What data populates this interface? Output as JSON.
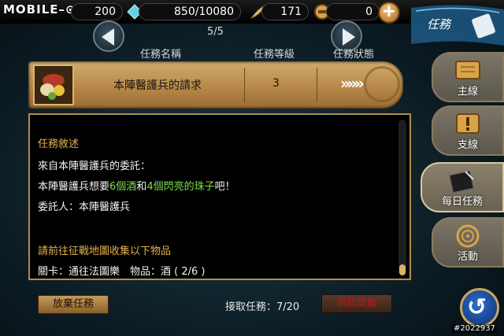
{
  "watermark": "MOBILE–",
  "resources": {
    "energy": "200",
    "crystal": "850/10080",
    "feather": "171",
    "coin": "0"
  },
  "plus_label": "+",
  "page_indicator": "5/5",
  "headers": {
    "name": "任務名稱",
    "level": "任務等級",
    "status": "任務狀態"
  },
  "quest": {
    "name": "本陣醫護兵的請求",
    "level": "3",
    "status": "»»»"
  },
  "detail": {
    "section1_title": "任務敘述",
    "line1": "來自本陣醫護兵的委託：",
    "line2_pre": "本陣醫護兵想要",
    "line2_item1": "6個酒",
    "line2_and": "和",
    "line2_item2": "4個閃亮的珠子",
    "line2_post": "吧！",
    "line3": "委託人：本陣醫護兵",
    "section2_title": "請前往征戰地圖收集以下物品",
    "line4": "關卡：通往法圖樂　物品：酒 ( 2/6 )"
  },
  "buttons": {
    "abandon": "放棄任務",
    "claim": "領取獎勵"
  },
  "accept_count": "接取任務：7/20",
  "sidebar": {
    "title": "任務",
    "tabs": [
      {
        "label": "主線",
        "icon": "scroll-icon"
      },
      {
        "label": "支線",
        "icon": "exclamation-icon"
      },
      {
        "label": "每日任務",
        "icon": "book-icon"
      },
      {
        "label": "活動",
        "icon": "target-icon"
      }
    ]
  },
  "image_id": "#2022937",
  "colors": {
    "gold": "#e3b24c",
    "green": "#7be04d",
    "claim_text": "#b01c1c"
  }
}
